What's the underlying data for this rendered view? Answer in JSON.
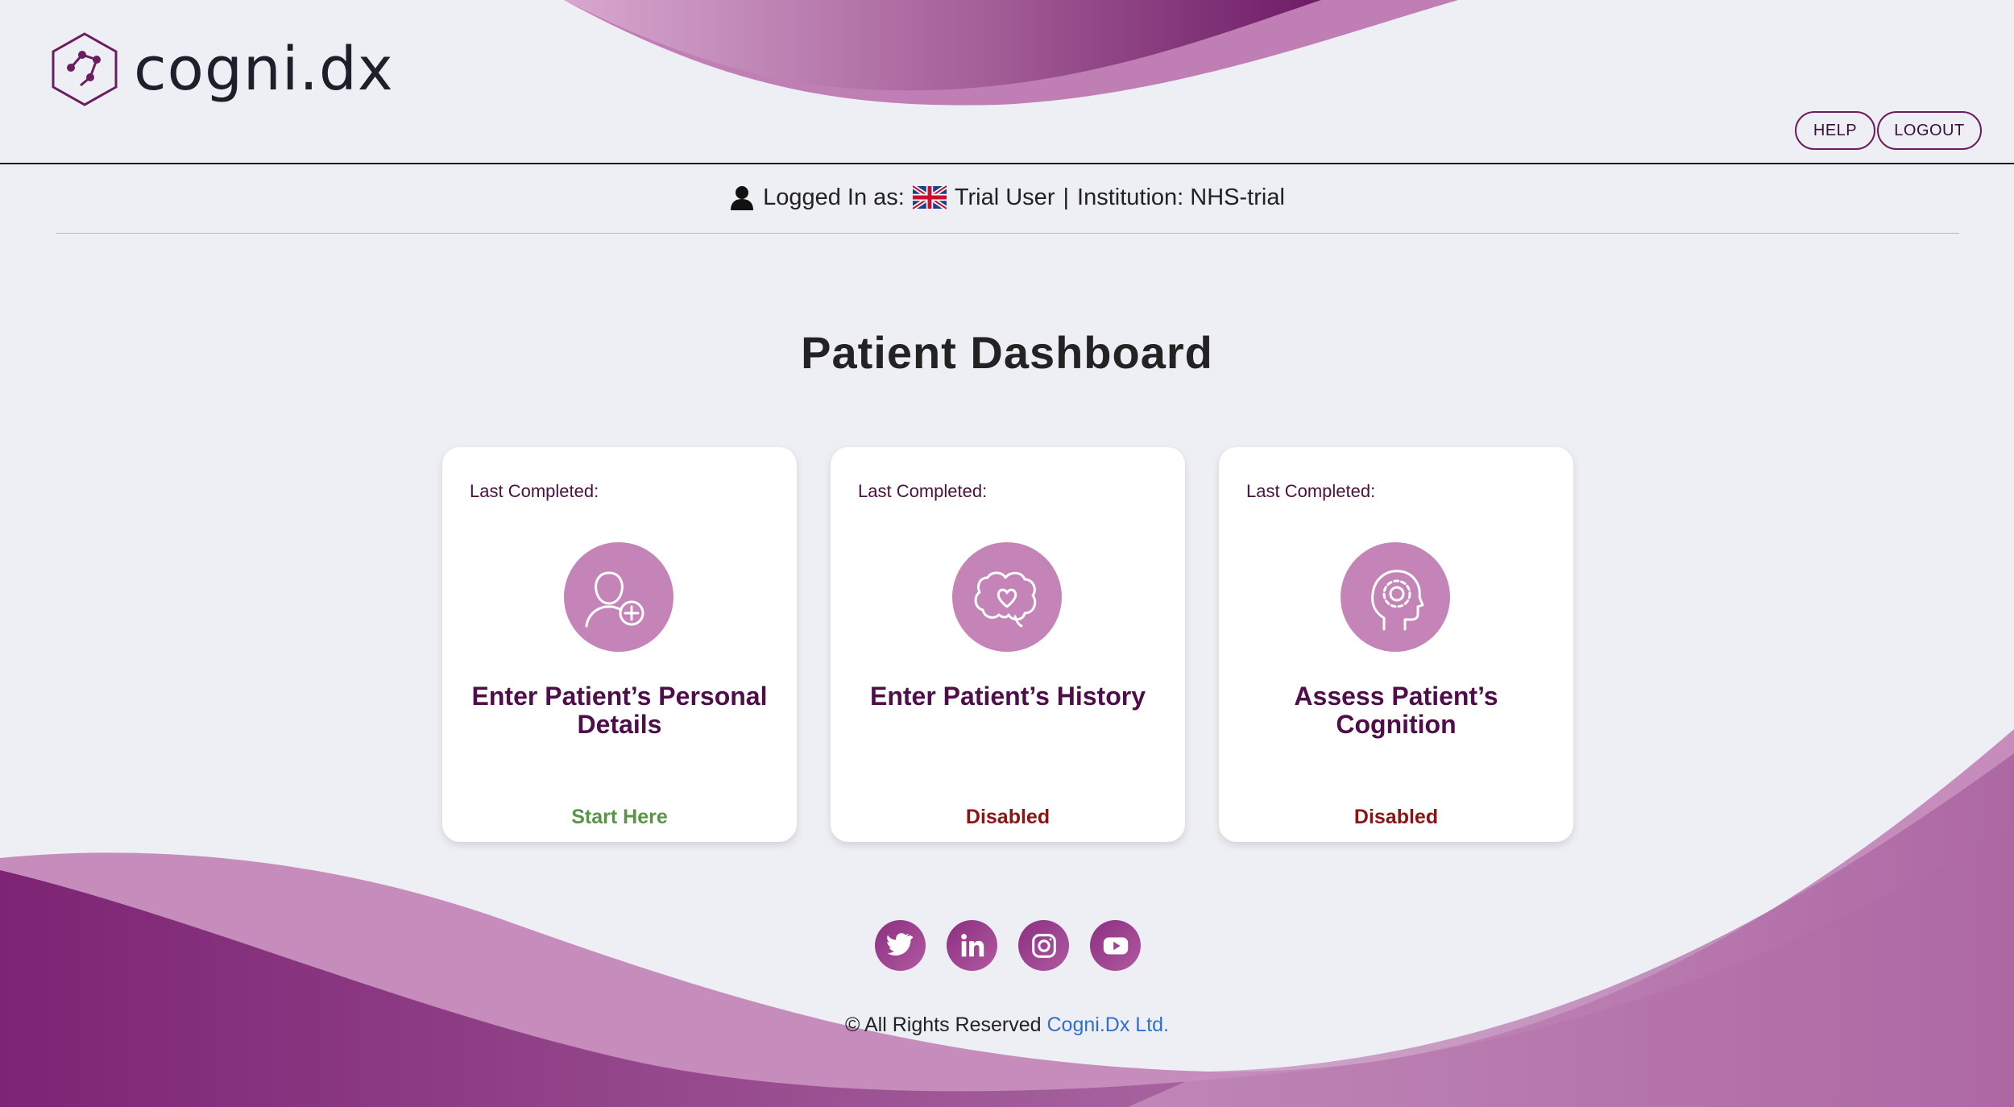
{
  "brand": {
    "name": "cogni.dx"
  },
  "header": {
    "help_label": "HELP",
    "logout_label": "LOGOUT"
  },
  "userbar": {
    "logged_in_prefix": "Logged In as:",
    "user_name": "Trial User",
    "separator": "|",
    "institution_label": "Institution: NHS-trial"
  },
  "page_title": "Patient Dashboard",
  "cards": [
    {
      "last_completed": "Last Completed:",
      "icon": "add-user-icon",
      "title": "Enter Patient’s Personal Details",
      "status": "Start Here",
      "status_color": "#5a9447"
    },
    {
      "last_completed": "Last Completed:",
      "icon": "brain-heart-icon",
      "title": "Enter Patient’s History",
      "status": "Disabled",
      "status_color": "#8b1414"
    },
    {
      "last_completed": "Last Completed:",
      "icon": "head-gear-icon",
      "title": "Assess Patient’s Cognition",
      "status": "Disabled",
      "status_color": "#8b1414"
    }
  ],
  "footer": {
    "socials": [
      "twitter-icon",
      "linkedin-icon",
      "instagram-icon",
      "youtube-icon"
    ],
    "copyright_text": "© All Rights Reserved",
    "company_link": "Cogni.Dx Ltd."
  },
  "colors": {
    "brand_purple": "#6b1e5f",
    "icon_circle": "#c584b7",
    "page_bg": "#eeeff5"
  }
}
